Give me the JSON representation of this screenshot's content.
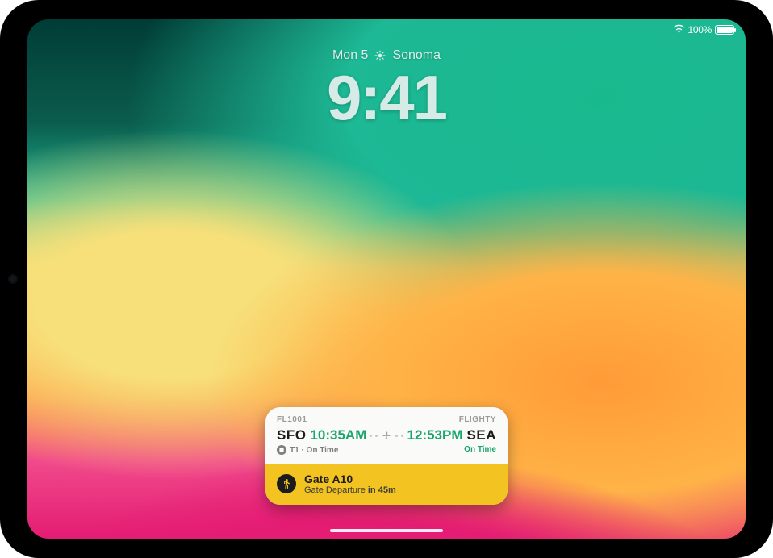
{
  "status": {
    "battery_pct": "100%"
  },
  "lockscreen": {
    "date": "Mon 5",
    "location": "Sonoma",
    "time": "9:41"
  },
  "widget": {
    "flight_no": "FL1001",
    "app_name": "FLIGHTY",
    "origin": "SFO",
    "depart_time": "10:35AM",
    "arrive_time": "12:53PM",
    "destination": "SEA",
    "terminal_label": "T1 · On Time",
    "dest_status": "On Time",
    "gate_title": "Gate A10",
    "gate_line_prefix": "Gate Departure ",
    "gate_timer": "in 45m",
    "colors": {
      "accent_green": "#1BA56C",
      "banner_yellow": "#F3C321"
    }
  }
}
